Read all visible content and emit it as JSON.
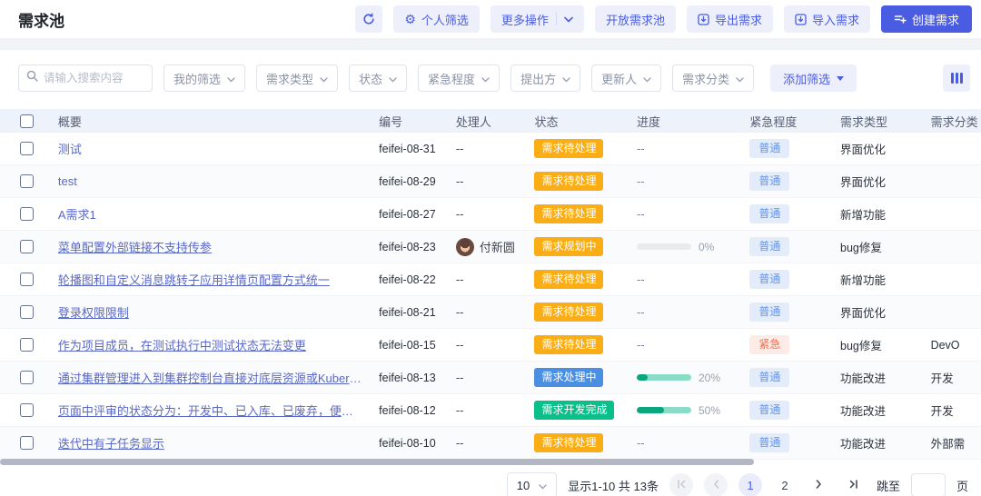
{
  "header": {
    "title": "需求池",
    "toolbar": {
      "personal_filter": "个人筛选",
      "more_actions": "更多操作",
      "open_pool": "开放需求池",
      "export_label": "导出需求",
      "import_label": "导入需求",
      "create_label": "创建需求"
    }
  },
  "filters": {
    "search_placeholder": "请输入搜索内容",
    "chips": [
      "我的筛选",
      "需求类型",
      "状态",
      "紧急程度",
      "提出方",
      "更新人",
      "需求分类"
    ],
    "add_filter": "添加筛选"
  },
  "table": {
    "columns": [
      "概要",
      "编号",
      "处理人",
      "状态",
      "进度",
      "紧急程度",
      "需求类型",
      "需求分类"
    ],
    "rows": [
      {
        "summary": "测试",
        "underline": false,
        "code": "feifei-08-31",
        "handler": "--",
        "handler_avatar": false,
        "status": "需求待处理",
        "status_variant": "orange",
        "progress_value": null,
        "progress_label": "--",
        "urgency": "普通",
        "urgency_variant": "normal",
        "type": "界面优化",
        "category": ""
      },
      {
        "summary": "test",
        "underline": false,
        "code": "feifei-08-29",
        "handler": "--",
        "handler_avatar": false,
        "status": "需求待处理",
        "status_variant": "orange",
        "progress_value": null,
        "progress_label": "--",
        "urgency": "普通",
        "urgency_variant": "normal",
        "type": "界面优化",
        "category": ""
      },
      {
        "summary": "A需求1",
        "underline": false,
        "code": "feifei-08-27",
        "handler": "--",
        "handler_avatar": false,
        "status": "需求待处理",
        "status_variant": "orange",
        "progress_value": null,
        "progress_label": "--",
        "urgency": "普通",
        "urgency_variant": "normal",
        "type": "新增功能",
        "category": ""
      },
      {
        "summary": "菜单配置外部链接不支持传参",
        "underline": true,
        "code": "feifei-08-23",
        "handler": "付新圆",
        "handler_avatar": true,
        "status": "需求规划中",
        "status_variant": "orange",
        "progress_value": 0,
        "progress_label": "0%",
        "urgency": "普通",
        "urgency_variant": "normal",
        "type": "bug修复",
        "category": ""
      },
      {
        "summary": "轮播图和自定义消息跳转子应用详情页配置方式统一",
        "underline": true,
        "code": "feifei-08-22",
        "handler": "--",
        "handler_avatar": false,
        "status": "需求待处理",
        "status_variant": "orange",
        "progress_value": null,
        "progress_label": "--",
        "urgency": "普通",
        "urgency_variant": "normal",
        "type": "新增功能",
        "category": ""
      },
      {
        "summary": "登录权限限制",
        "underline": true,
        "code": "feifei-08-21",
        "handler": "--",
        "handler_avatar": false,
        "status": "需求待处理",
        "status_variant": "orange",
        "progress_value": null,
        "progress_label": "--",
        "urgency": "普通",
        "urgency_variant": "normal",
        "type": "界面优化",
        "category": ""
      },
      {
        "summary": "作为项目成员，在测试执行中测试状态无法变更",
        "underline": true,
        "code": "feifei-08-15",
        "handler": "--",
        "handler_avatar": false,
        "status": "需求待处理",
        "status_variant": "orange",
        "progress_value": null,
        "progress_label": "--",
        "urgency": "紧急",
        "urgency_variant": "urgent",
        "type": "bug修复",
        "category": "DevO"
      },
      {
        "summary": "通过集群管理进入到集群控制台直接对底层资源或Kubernetes…",
        "underline": true,
        "code": "feifei-08-13",
        "handler": "--",
        "handler_avatar": false,
        "status": "需求处理中",
        "status_variant": "blue",
        "progress_value": 20,
        "progress_label": "20%",
        "urgency": "普通",
        "urgency_variant": "normal",
        "type": "功能改进",
        "category": "开发"
      },
      {
        "summary": "页面中评审的状态分为：开发中、已入库、已废弃，便于回溯…",
        "underline": true,
        "code": "feifei-08-12",
        "handler": "--",
        "handler_avatar": false,
        "status": "需求开发完成",
        "status_variant": "green",
        "progress_value": 50,
        "progress_label": "50%",
        "urgency": "普通",
        "urgency_variant": "normal",
        "type": "功能改进",
        "category": "开发"
      },
      {
        "summary": "迭代中有子任务显示",
        "underline": true,
        "code": "feifei-08-10",
        "handler": "--",
        "handler_avatar": false,
        "status": "需求待处理",
        "status_variant": "orange",
        "progress_value": null,
        "progress_label": "--",
        "urgency": "普通",
        "urgency_variant": "normal",
        "type": "功能改进",
        "category": "外部需"
      }
    ]
  },
  "pagination": {
    "page_size": "10",
    "summary": "显示1-10 共 13条",
    "current_page": "1",
    "page_two": "2",
    "jump_label": "跳至",
    "page_unit": "页"
  },
  "colors": {
    "accent": "#4a5ce1",
    "button_bg": "#edf0fa",
    "status_orange": "#faad14",
    "status_blue": "#4a8fe2",
    "status_green": "#0bbf8b",
    "urgency_normal_bg": "#e2ecfb",
    "urgency_normal_text": "#6695e8",
    "urgency_urgent_bg": "#fdebe6",
    "urgency_urgent_text": "#f56a4d",
    "progress_fill": "#0aa67e",
    "progress_track": "#8bdcc6",
    "link": "#5a68c6",
    "table_header_bg": "#edf2fb"
  }
}
